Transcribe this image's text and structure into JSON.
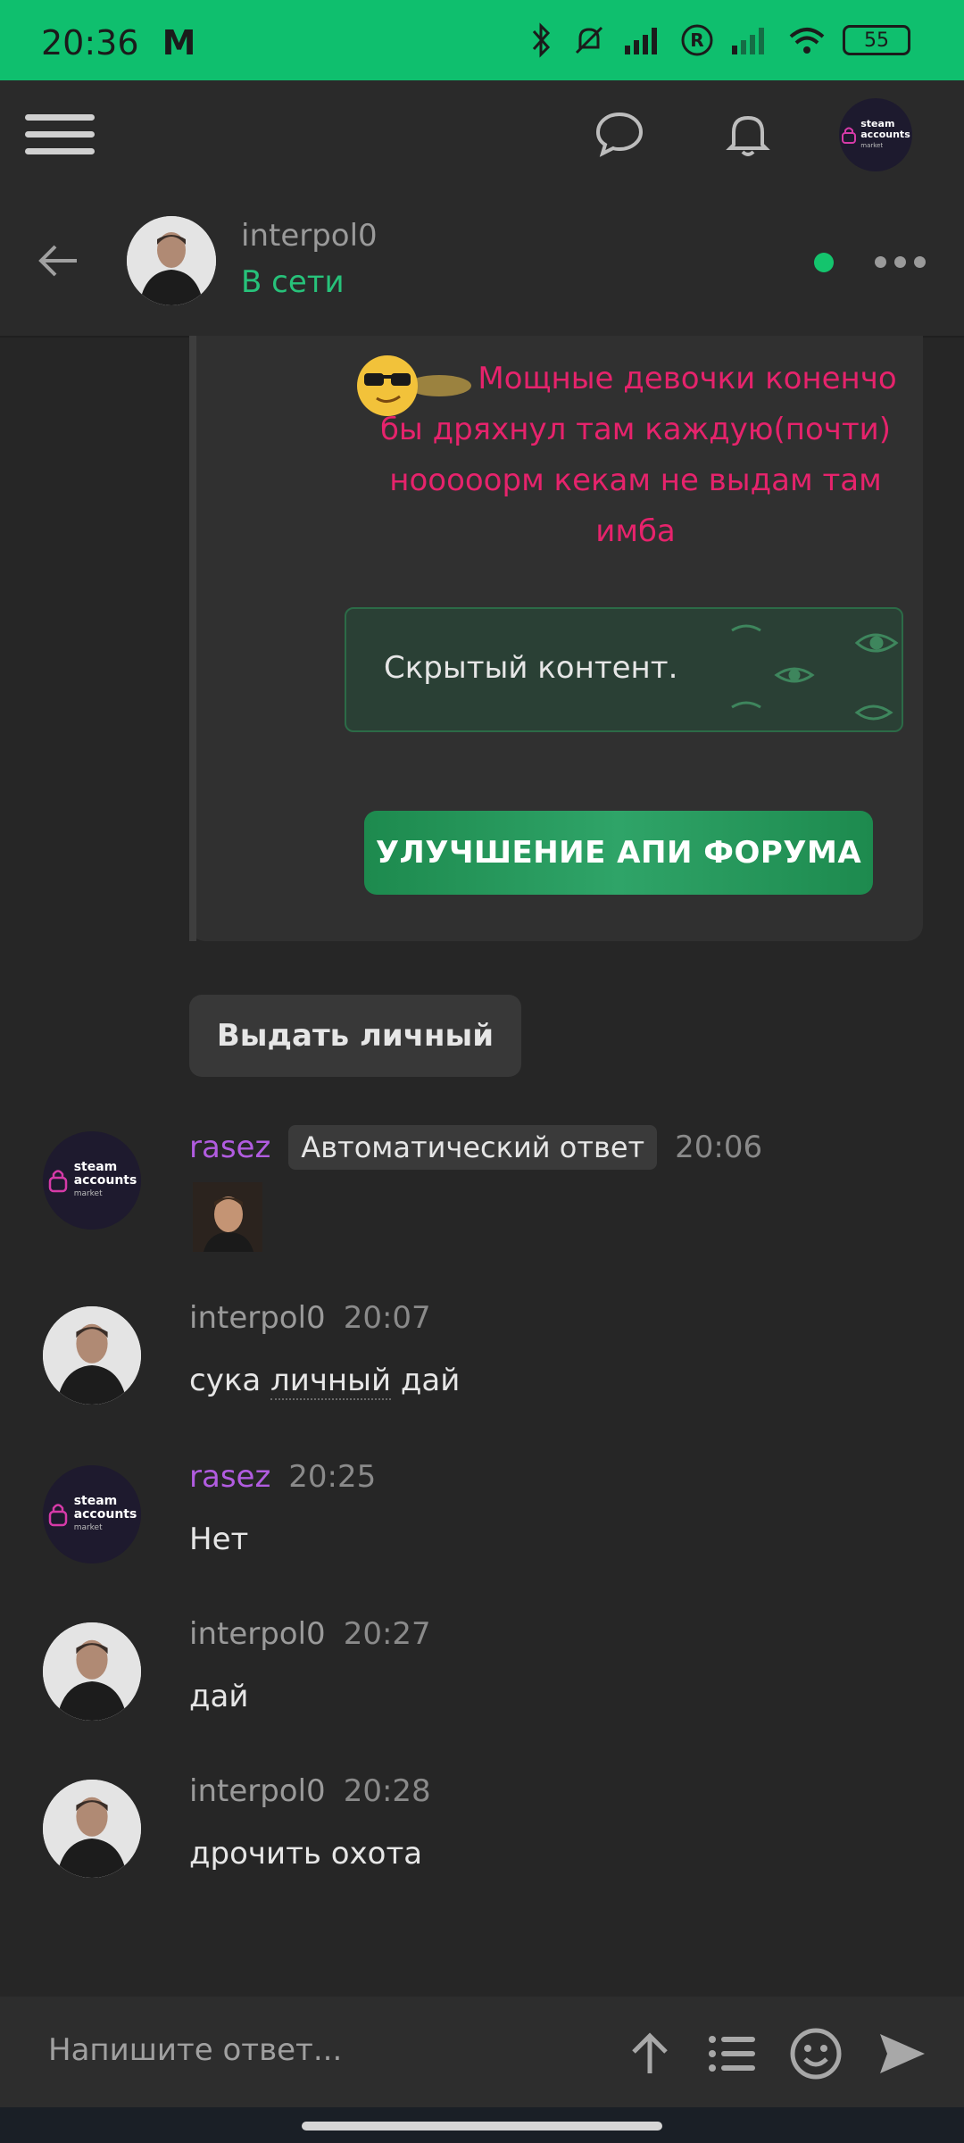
{
  "status_bar": {
    "time": "20:36",
    "carrier_glyph": "M",
    "battery": "55"
  },
  "chat_header": {
    "username": "interpol0",
    "status": "В сети"
  },
  "quoted_message": {
    "text_lines": [
      "Мощные девочки коненчо",
      "бы дряхнул там каждую(почти)",
      "нооооорм кекам не выдам там",
      "имба"
    ],
    "hidden_content": "Скрытый контент.",
    "upgrade_button": "УЛУЧШЕНИЕ АПИ ФОРУМА"
  },
  "issue_button": "Выдать личный",
  "brand": {
    "line1": "steam",
    "line2": "accounts",
    "line3": "market"
  },
  "messages": [
    {
      "user": "rasez",
      "badge": "Автоматический ответ",
      "time": "20:06",
      "text": ""
    },
    {
      "user": "interpol0",
      "time": "20:07",
      "text_part1": "сука ",
      "text_part2": "личный",
      "text_part3": " дай"
    },
    {
      "user": "rasez",
      "time": "20:25",
      "text": "Нет"
    },
    {
      "user": "interpol0",
      "time": "20:27",
      "text": "дай"
    },
    {
      "user": "interpol0",
      "time": "20:28",
      "text": "дрочить охота"
    }
  ],
  "composer": {
    "placeholder": "Напишите ответ..."
  },
  "colors": {
    "accent_green": "#0fbf6e",
    "username_purple": "#b15ce0",
    "quote_pink": "#e6236c"
  },
  "icons": [
    "menu-icon",
    "chat-bubble-icon",
    "bell-icon",
    "back-arrow-icon",
    "more-icon",
    "arrow-up-icon",
    "list-icon",
    "smile-icon",
    "send-icon"
  ]
}
